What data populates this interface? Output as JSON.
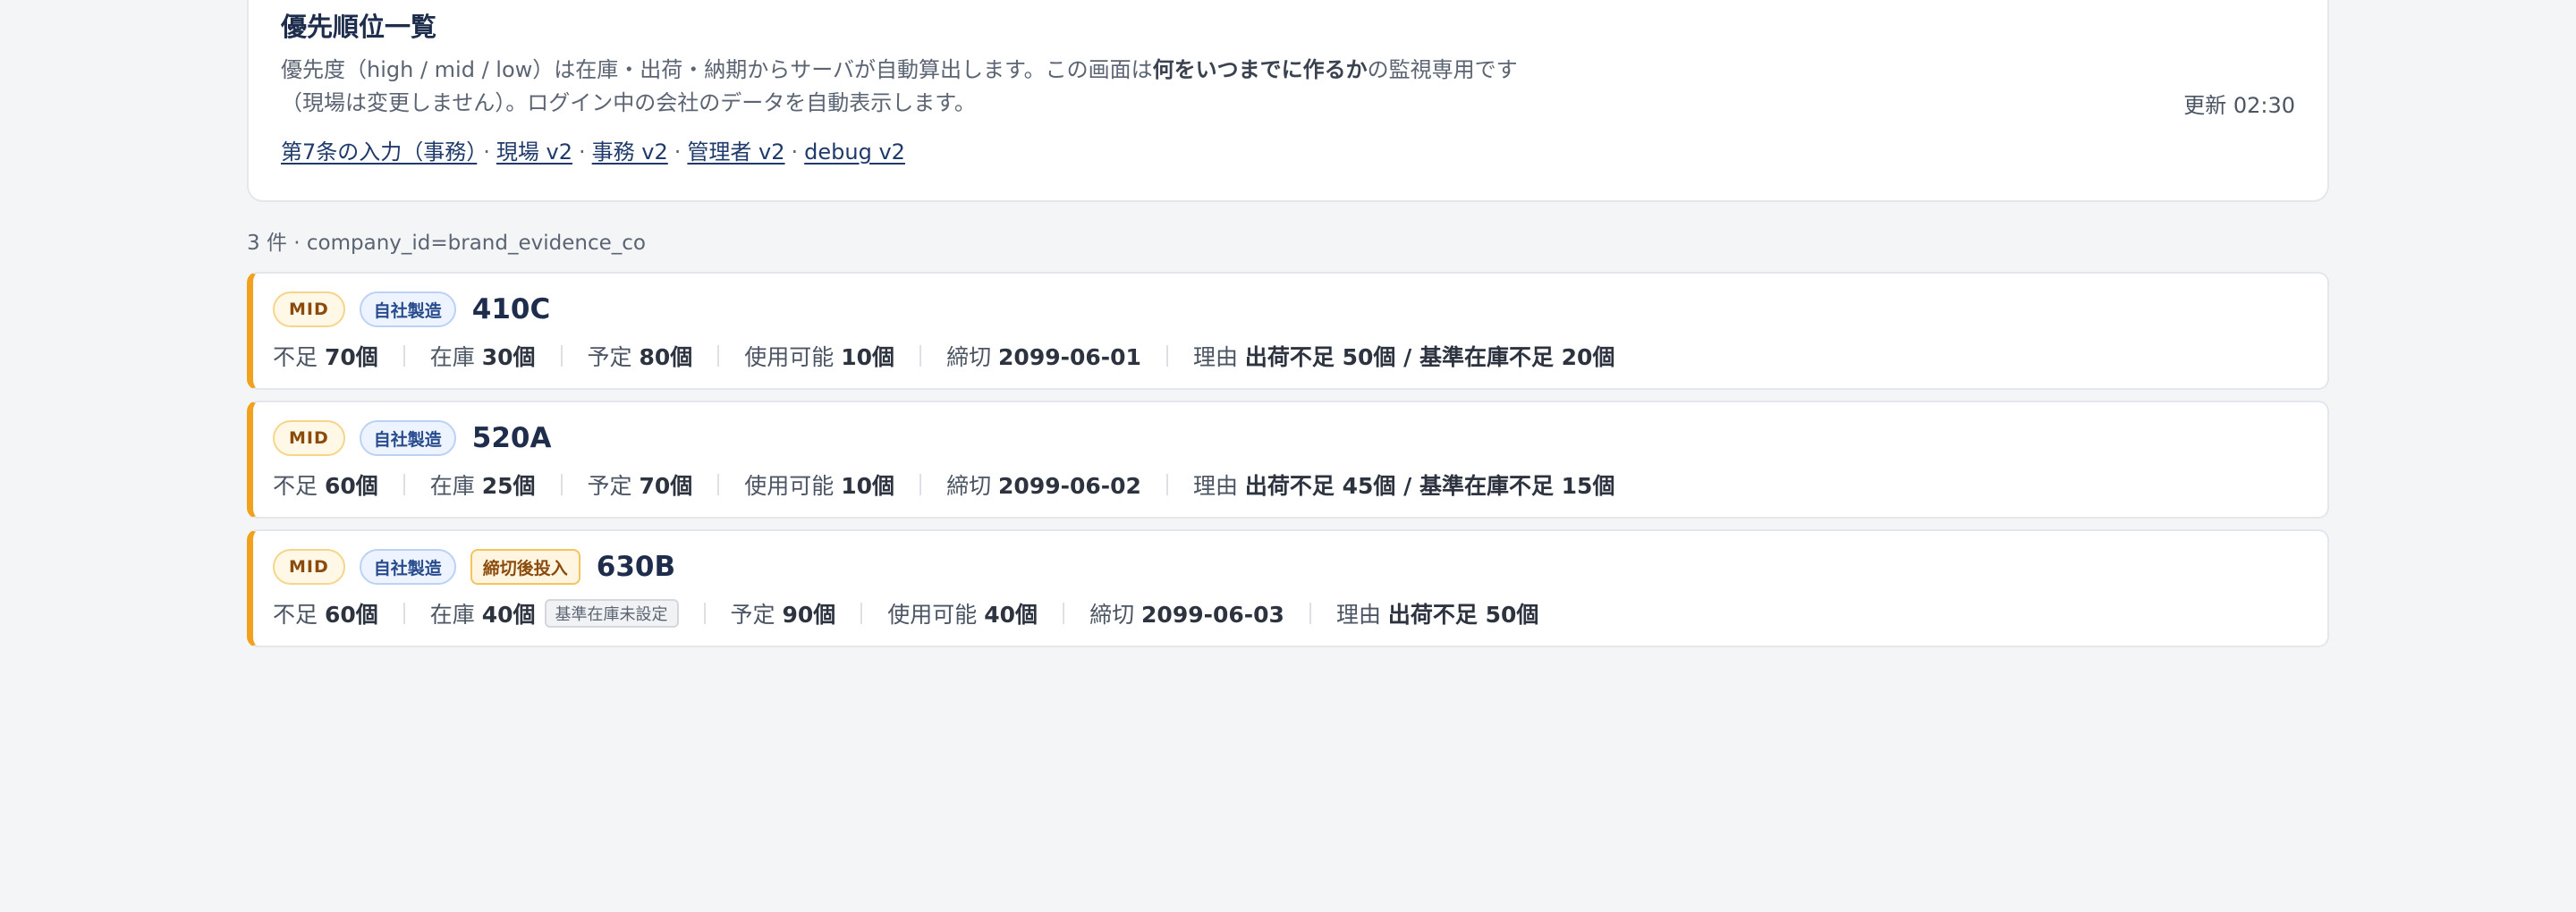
{
  "header": {
    "title": "優先順位一覧",
    "desc_pre": "優先度（high / mid / low）は在庫・出荷・納期からサーバが自動算出します。この画面は",
    "desc_bold": "何をいつまでに作るか",
    "desc_post": "の監視専用です",
    "desc_line2": "（現場は変更しません）。ログイン中の会社のデータを自動表示します。",
    "updated": "更新 02:30",
    "links": [
      {
        "label": "第7条の入力（事務）"
      },
      {
        "label": "現場 v2"
      },
      {
        "label": "事務 v2"
      },
      {
        "label": "管理者 v2"
      },
      {
        "label": "debug v2"
      }
    ],
    "link_separator": "·"
  },
  "count_line": "3 件 · company_id=brand_evidence_co",
  "labels": {
    "shortage": "不足",
    "stock": "在庫",
    "planned": "予定",
    "available": "使用可能",
    "deadline": "締切",
    "reason": "理由"
  },
  "items": [
    {
      "priority": "MID",
      "source": "自社製造",
      "extra_badge": "",
      "sku": "410C",
      "shortage": "70個",
      "stock": "30個",
      "stock_note": "",
      "planned": "80個",
      "available": "10個",
      "deadline": "2099-06-01",
      "reason": "出荷不足 50個 / 基準在庫不足 20個"
    },
    {
      "priority": "MID",
      "source": "自社製造",
      "extra_badge": "",
      "sku": "520A",
      "shortage": "60個",
      "stock": "25個",
      "stock_note": "",
      "planned": "70個",
      "available": "10個",
      "deadline": "2099-06-02",
      "reason": "出荷不足 45個 / 基準在庫不足 15個"
    },
    {
      "priority": "MID",
      "source": "自社製造",
      "extra_badge": "締切後投入",
      "sku": "630B",
      "shortage": "60個",
      "stock": "40個",
      "stock_note": "基準在庫未設定",
      "planned": "90個",
      "available": "40個",
      "deadline": "2099-06-03",
      "reason": "出荷不足 50個"
    }
  ],
  "colors": {
    "accent_left_border": "#f2a11c",
    "title": "#1f2d4d",
    "background": "#f4f5f7"
  }
}
